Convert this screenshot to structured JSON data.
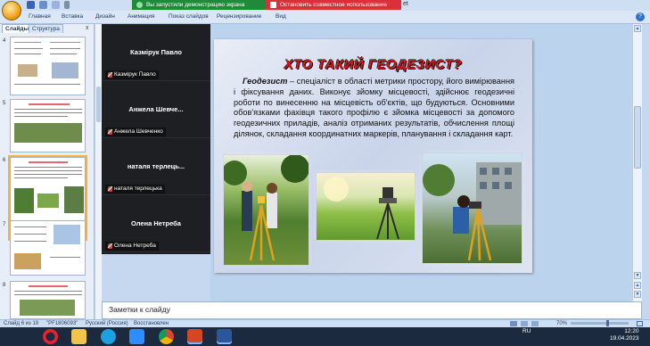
{
  "titlebar": {
    "share_banner": "Вы запустили демонстрацию экрана",
    "stop_share": "Остановить совместное использование",
    "title_suffix": "et"
  },
  "ribbon": {
    "tabs": [
      "Главная",
      "Вставка",
      "Дизайн",
      "Анимация",
      "Показ слайдов",
      "Рецензирование",
      "Вид"
    ],
    "help": "?"
  },
  "left_panel": {
    "tabs": [
      "Слайды",
      "Структура"
    ],
    "close": "x",
    "thumb_numbers": [
      "4",
      "5",
      "6",
      "7",
      "8"
    ],
    "selected_slide": 6
  },
  "video_panel": {
    "participants": [
      {
        "name": "Казмірук Павло",
        "label": "Казмірук Павло"
      },
      {
        "name": "Анжела Шевче...",
        "label": "Анжела Шевченко"
      },
      {
        "name": "наталя терлець...",
        "label": "наталя терлецька"
      },
      {
        "name": "Олена Нетреба",
        "label": "Олена Нетреба"
      }
    ]
  },
  "slide": {
    "title": "ХТО ТАКИЙ ГЕОДЕЗИСТ?",
    "term": "Геодезист",
    "body": " – спеціаліст в області метрики простору, його вимірювання і фіксування даних. Виконує зйомку місцевості, здійснює геодезичні роботи по винесенню на місцевість об'єктів, що будуються. Основними обов'язками фахівця такого профілю є зйомка місцевості за допомого геодезичних приладів, аналіз отриманих результатів, обчислення площі ділянок, складання координатних маркерів, планування і складання карт."
  },
  "notes": {
    "placeholder": "Заметки к слайду"
  },
  "statusbar": {
    "slide_info": "Слайд 6 из 19",
    "theme": "\"PF1806093\"",
    "language": "Русский (Россия)",
    "restored": "Восстановлен",
    "zoom": "70%",
    "zoom_fraction": 0.7
  },
  "taskbar": {
    "apps": [
      "opera-icon",
      "file-explorer-icon",
      "skype-icon",
      "zoom-icon",
      "chrome-icon",
      "powerpoint-icon",
      "word-icon"
    ],
    "lang": "RU",
    "time": "12:20",
    "date": "19.04.2023"
  }
}
